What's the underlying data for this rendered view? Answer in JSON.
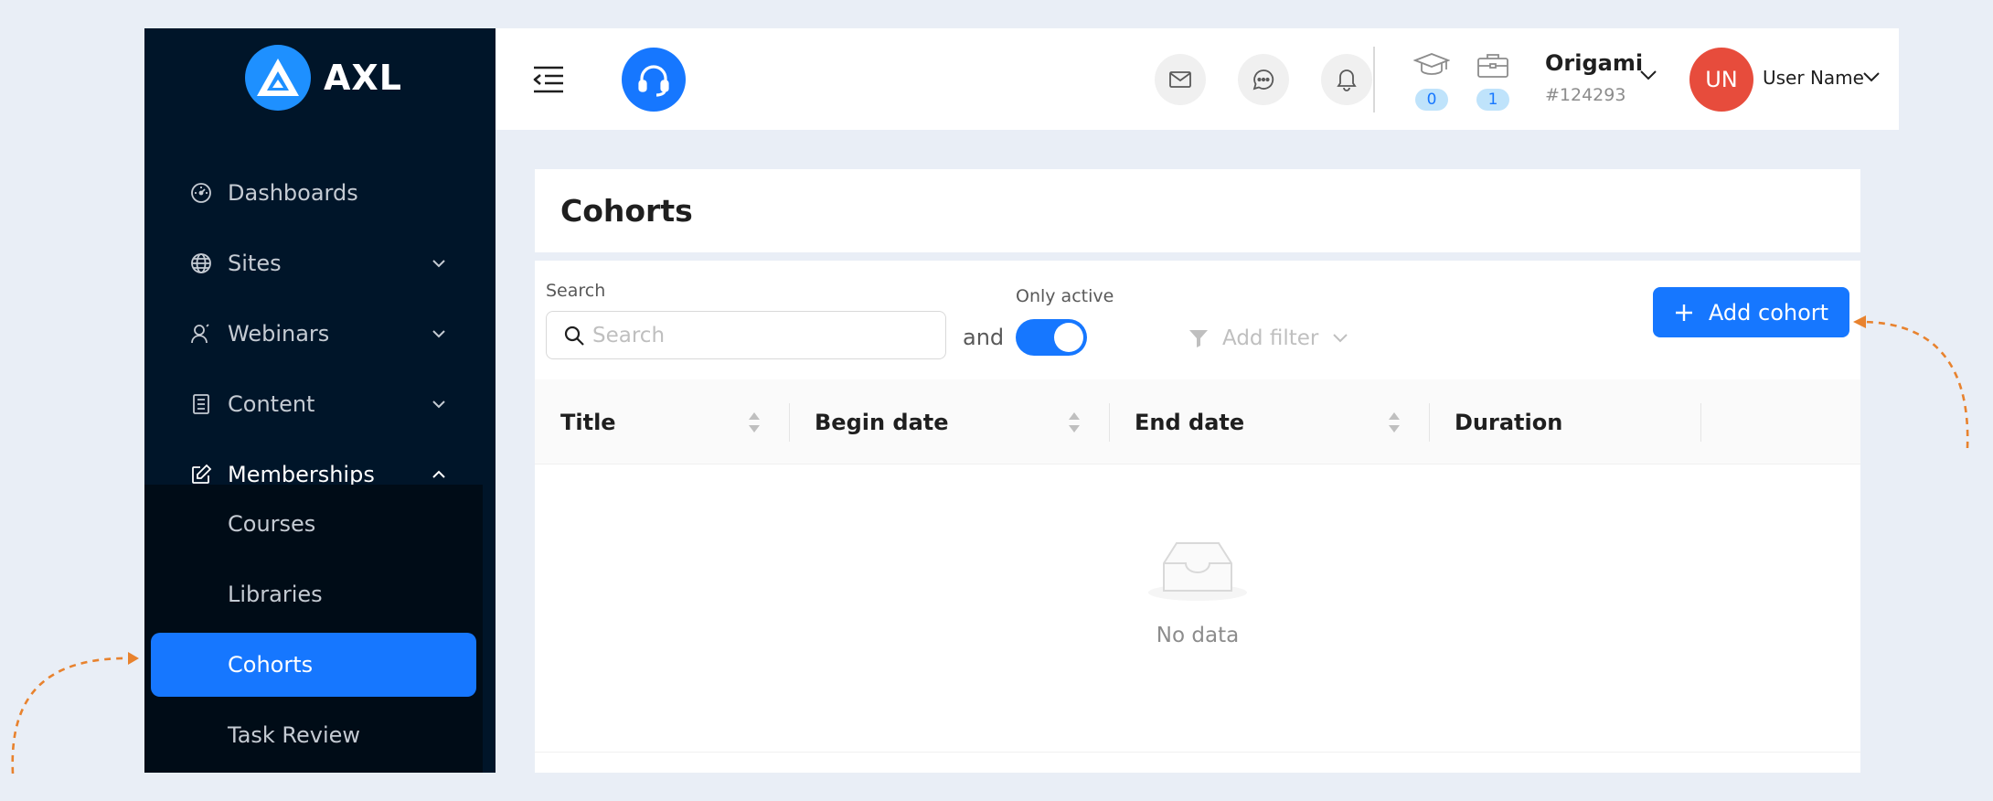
{
  "brand": {
    "name": "AXL"
  },
  "sidebar": {
    "items": [
      {
        "label": "Dashboards"
      },
      {
        "label": "Sites"
      },
      {
        "label": "Webinars"
      },
      {
        "label": "Content"
      },
      {
        "label": "Memberships"
      }
    ],
    "submenu": [
      {
        "label": "Courses"
      },
      {
        "label": "Libraries"
      },
      {
        "label": "Cohorts"
      },
      {
        "label": "Task Review"
      }
    ]
  },
  "header": {
    "stats": [
      {
        "value": "0"
      },
      {
        "value": "1"
      }
    ],
    "org": {
      "name": "Origami",
      "id": "#124293"
    },
    "user": {
      "initials": "UN",
      "name": "User Name"
    },
    "colors": {
      "accent": "#1677ff",
      "avatar": "#e74c3c",
      "sidebar": "#001529"
    }
  },
  "page": {
    "title": "Cohorts"
  },
  "toolbar": {
    "search_label": "Search",
    "search_placeholder": "Search",
    "and": "and",
    "only_active_label": "Only active",
    "only_active": true,
    "filter_label": "Add filter",
    "add_label": "Add cohort"
  },
  "table": {
    "columns": [
      {
        "label": "Title"
      },
      {
        "label": "Begin date"
      },
      {
        "label": "End date"
      },
      {
        "label": "Duration"
      }
    ],
    "empty_text": "No data"
  }
}
